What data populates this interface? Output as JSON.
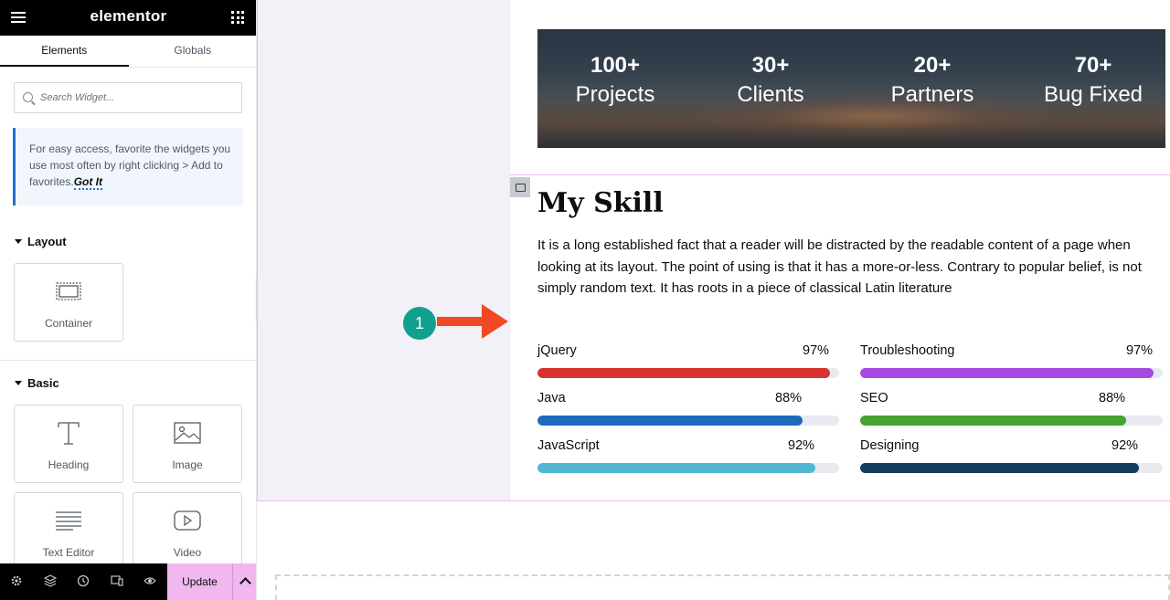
{
  "sidebar": {
    "brand": "elementor",
    "tabs": [
      "Elements",
      "Globals"
    ],
    "search": {
      "placeholder": "Search Widget..."
    },
    "tip": {
      "text": "For easy access, favorite the widgets you use most often by right clicking > Add to favorites.",
      "link": "Got It"
    },
    "layout": {
      "title": "Layout",
      "widgets": [
        {
          "label": "Container",
          "icon": "container-icon"
        }
      ]
    },
    "basic": {
      "title": "Basic",
      "widgets": [
        {
          "label": "Heading",
          "icon": "heading-icon"
        },
        {
          "label": "Image",
          "icon": "image-icon"
        },
        {
          "label": "Text Editor",
          "icon": "text-editor-icon"
        },
        {
          "label": "Video",
          "icon": "video-icon"
        }
      ]
    },
    "bottom": {
      "icons": [
        "settings-icon",
        "layers-icon",
        "history-icon",
        "responsive-icon",
        "preview-icon"
      ],
      "update_label": "Update",
      "accent": "#f0b8ee"
    }
  },
  "stats": [
    {
      "value": "100+",
      "label": "Projects"
    },
    {
      "value": "30+",
      "label": "Clients"
    },
    {
      "value": "20+",
      "label": "Partners"
    },
    {
      "value": "70+",
      "label": "Bug Fixed"
    }
  ],
  "skills_section": {
    "title": "My Skill",
    "description": "It is a long established fact that a reader will be distracted by the readable content of a page when looking at its layout. The point of using is that it has a more-or-less. Contrary to popular belief, is not simply random text. It has roots in a piece of classical Latin literature",
    "annotation": "1",
    "left_skills": [
      {
        "name": "jQuery",
        "percent_label": "97%",
        "value": 97,
        "color": "#d6332e"
      },
      {
        "name": "Java",
        "percent_label": "88%",
        "value": 88,
        "color": "#1e6bbd"
      },
      {
        "name": "JavaScript",
        "percent_label": "92%",
        "value": 92,
        "color": "#4fb7d2"
      }
    ],
    "right_skills": [
      {
        "name": "Troubleshooting",
        "percent_label": "97%",
        "value": 97,
        "color": "#a64be0"
      },
      {
        "name": "SEO",
        "percent_label": "88%",
        "value": 88,
        "color": "#45a32e"
      },
      {
        "name": "Designing",
        "percent_label": "92%",
        "value": 92,
        "color": "#123d5e"
      }
    ]
  }
}
